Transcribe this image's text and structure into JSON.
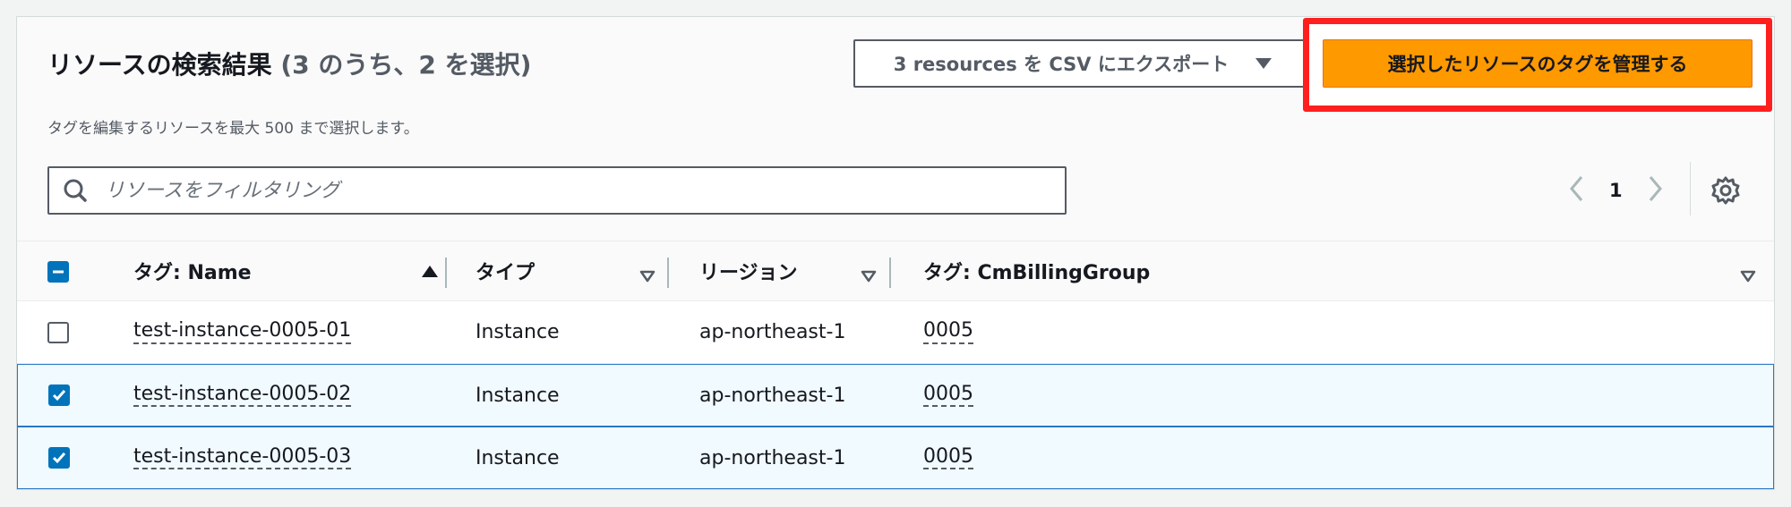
{
  "header": {
    "title": "リソースの検索結果",
    "count": "(3 のうち、2 を選択)",
    "description": "タグを編集するリソースを最大 500 まで選択します。"
  },
  "toolbar": {
    "export_label": "3 resources を CSV にエクスポート",
    "manage_label": "選択したリソースのタグを管理する"
  },
  "search": {
    "placeholder": "リソースをフィルタリング",
    "value": ""
  },
  "pagination": {
    "current_page": "1"
  },
  "table": {
    "columns": [
      {
        "label": "タグ: Name",
        "sort": "ascending"
      },
      {
        "label": "タイプ",
        "sort": "none"
      },
      {
        "label": "リージョン",
        "sort": "none"
      },
      {
        "label": "タグ: CmBillingGroup",
        "sort": "none"
      }
    ],
    "header_checkbox": "indeterminate",
    "rows": [
      {
        "name": "test-instance-0005-01",
        "type": "Instance",
        "region": "ap-northeast-1",
        "billing_group": "0005",
        "selected": false
      },
      {
        "name": "test-instance-0005-02",
        "type": "Instance",
        "region": "ap-northeast-1",
        "billing_group": "0005",
        "selected": true
      },
      {
        "name": "test-instance-0005-03",
        "type": "Instance",
        "region": "ap-northeast-1",
        "billing_group": "0005",
        "selected": true
      }
    ]
  },
  "colors": {
    "primary_button": "#ff9900",
    "highlight_border": "#ff1f1f",
    "checkbox_checked": "#0073bb",
    "selected_row_bg": "#f1faff",
    "selected_row_border": "#2779c4"
  }
}
